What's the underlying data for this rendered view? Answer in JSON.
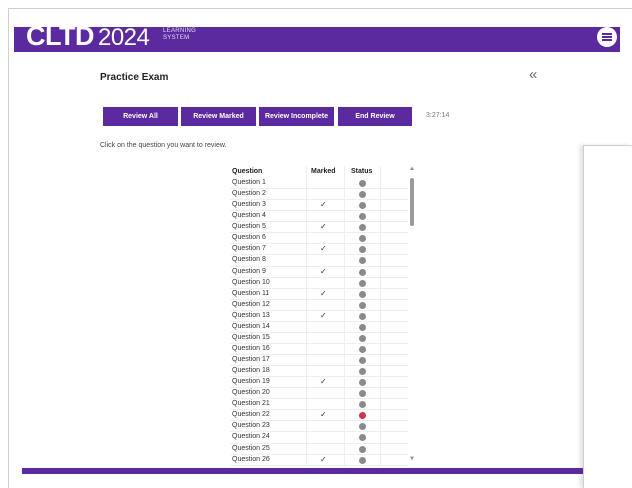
{
  "header": {
    "logo_main": "CLTD",
    "logo_year": "2024",
    "logo_sub_1": "LEARNING",
    "logo_sub_2": "SYSTEM",
    "menu_icon": "hamburger-menu-icon",
    "accent_color": "#5b2a9f"
  },
  "page": {
    "title": "Practice Exam",
    "collapse_glyph": "«",
    "instruction": "Click on the question you want to review.",
    "timer": "3:27:14"
  },
  "buttons": {
    "review_all": "Review All",
    "review_marked": "Review Marked",
    "review_incomplete": "Review Incomplete",
    "end_review": "End Review"
  },
  "table": {
    "headers": {
      "question": "Question",
      "marked": "Marked",
      "status": "Status"
    },
    "rows": [
      {
        "label": "Question 1",
        "marked": "",
        "status": "gray"
      },
      {
        "label": "Question 2",
        "marked": "",
        "status": "gray"
      },
      {
        "label": "Question 3",
        "marked": "✓",
        "status": "gray"
      },
      {
        "label": "Question 4",
        "marked": "",
        "status": "gray"
      },
      {
        "label": "Question 5",
        "marked": "✓",
        "status": "gray"
      },
      {
        "label": "Question 6",
        "marked": "",
        "status": "gray"
      },
      {
        "label": "Question 7",
        "marked": "✓",
        "status": "gray"
      },
      {
        "label": "Question 8",
        "marked": "",
        "status": "gray"
      },
      {
        "label": "Question 9",
        "marked": "✓",
        "status": "gray"
      },
      {
        "label": "Question 10",
        "marked": "",
        "status": "gray"
      },
      {
        "label": "Question 11",
        "marked": "✓",
        "status": "gray"
      },
      {
        "label": "Question 12",
        "marked": "",
        "status": "gray"
      },
      {
        "label": "Question 13",
        "marked": "✓",
        "status": "gray"
      },
      {
        "label": "Question 14",
        "marked": "",
        "status": "gray"
      },
      {
        "label": "Question 15",
        "marked": "",
        "status": "gray"
      },
      {
        "label": "Question 16",
        "marked": "",
        "status": "gray"
      },
      {
        "label": "Question 17",
        "marked": "",
        "status": "gray"
      },
      {
        "label": "Question 18",
        "marked": "",
        "status": "gray"
      },
      {
        "label": "Question 19",
        "marked": "✓",
        "status": "gray"
      },
      {
        "label": "Question 20",
        "marked": "",
        "status": "gray"
      },
      {
        "label": "Question 21",
        "marked": "",
        "status": "gray"
      },
      {
        "label": "Question 22",
        "marked": "✓",
        "status": "red"
      },
      {
        "label": "Question 23",
        "marked": "",
        "status": "gray"
      },
      {
        "label": "Question 24",
        "marked": "",
        "status": "gray"
      },
      {
        "label": "Question 25",
        "marked": "",
        "status": "gray"
      },
      {
        "label": "Question 26",
        "marked": "✓",
        "status": "gray"
      }
    ],
    "status_colors": {
      "gray": "#8a8a8a",
      "red": "#d0344a"
    }
  }
}
